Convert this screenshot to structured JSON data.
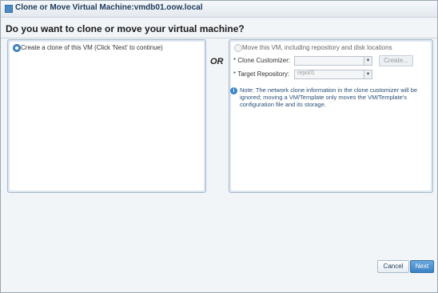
{
  "window": {
    "title": "Clone or Move Virtual Machine:vmdb01.oow.local"
  },
  "question": "Do you want to clone or move your virtual machine?",
  "left_option": {
    "label": "Create a clone of this VM (Click 'Next' to continue)",
    "selected": true
  },
  "or_label": "OR",
  "right_option": {
    "label": "Move this VM, including repository and disk locations",
    "selected": false,
    "clone_customizer": {
      "label": "* Clone Customizer:",
      "value": ""
    },
    "create_button": "Create...",
    "target_repository": {
      "label": "* Target Repository:",
      "value": "repo01"
    },
    "note": "Note: The network clone information in the clone customizer will be ignored; moving a VM/Template only moves the VM/Template's configuration file and its storage."
  },
  "buttons": {
    "cancel": "Cancel",
    "next": "Next"
  },
  "colors": {
    "accent": "#3b82c4",
    "panel_bg": "#dde7f2",
    "note_text": "#2a4e76"
  },
  "icons": {
    "title": "window-icon",
    "info": "info-icon",
    "dropdown": "chevron-down-icon"
  }
}
